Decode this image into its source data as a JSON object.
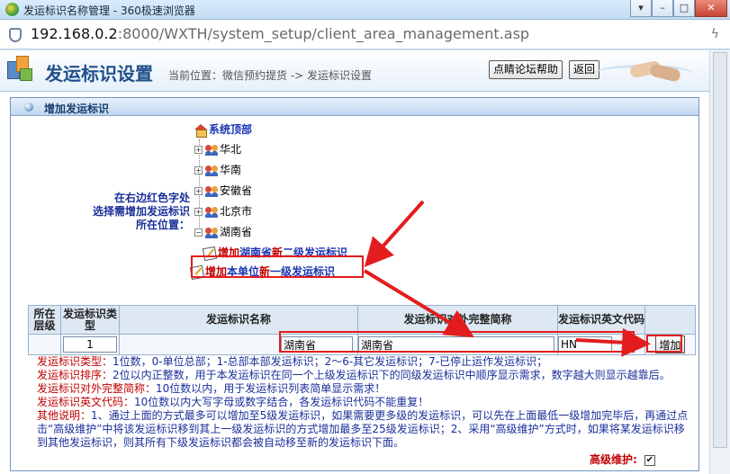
{
  "window": {
    "title": "发运标识名称管理 - 360极速浏览器",
    "btn_menu": "▾",
    "btn_min": "–",
    "btn_max": "□",
    "btn_close": "✕"
  },
  "address": {
    "url_host": "192.168.0.2",
    "url_rest": ":8000/WXTH/system_setup/client_area_management.asp"
  },
  "header": {
    "title": "发运标识设置",
    "breadcrumb": "当前位置：微信预约提货 -> 发运标识设置",
    "help_button": "点睛论坛帮助",
    "back_button": "返回"
  },
  "panel": {
    "title": "增加发运标识",
    "prompt_line1": "在右边红色字处",
    "prompt_line2": "选择需增加发运标识",
    "prompt_line3": "所在位置：",
    "root": "系统顶部",
    "regions": [
      "华北",
      "华南",
      "安徽省",
      "北京市",
      "湖南省"
    ],
    "add_sub": {
      "pre": "增加",
      "place": "湖南省",
      "mid": "新",
      "post": "二级发运标识"
    },
    "add_top": {
      "pre": "增加",
      "place": "本单位",
      "mid": "新",
      "post": "一级发运标识"
    }
  },
  "table": {
    "headers": {
      "level": "所在层级",
      "type": "发运标识类型",
      "name": "发运标识名称",
      "fullname": "发运标识对外完整简称",
      "code": "发运标识英文代码"
    },
    "row": {
      "type": "1",
      "name": "湖南省",
      "fullname": "湖南省",
      "code": "HN"
    },
    "add_button": "增加"
  },
  "notes": [
    {
      "k": "发运标识类型：",
      "v": "1位数，0-单位总部；1-总部本部发运标识；2～6-其它发运标识；7-已停止运作发运标识；"
    },
    {
      "k": "发运标识排序：",
      "v": "2位以内正整数，用于本发运标识在同一个上级发运标识下的同级发运标识中顺序显示需求，数字越大则显示越靠后。"
    },
    {
      "k": "发运标识对外完整简称：",
      "v": "10位数以内，用于发运标识列表简单显示需求！"
    },
    {
      "k": "发运标识英文代码：",
      "v": "10位数以内大写字母或数字结合，各发运标识代码不能重复！"
    },
    {
      "k": "其他说明：",
      "v": "1、通过上面的方式最多可以增加至5级发运标识，如果需要更多级的发运标识，可以先在上面最低一级增加完毕后，再通过点击“高级维护”中将该发运标识移到其上一级发运标识的方式增加最多至25级发运标识；2、采用“高级维护”方式时，如果将某发运标识移到其他发运标识，则其所有下级发运标识都会被自动移至新的发运标识下面。"
    }
  ],
  "advanced": {
    "label": "高级维护:",
    "checked_mark": "✔"
  },
  "colors": {
    "accent_blue": "#1a35b5",
    "alert_red": "#e31d1d",
    "panel_border": "#6e95c2"
  }
}
